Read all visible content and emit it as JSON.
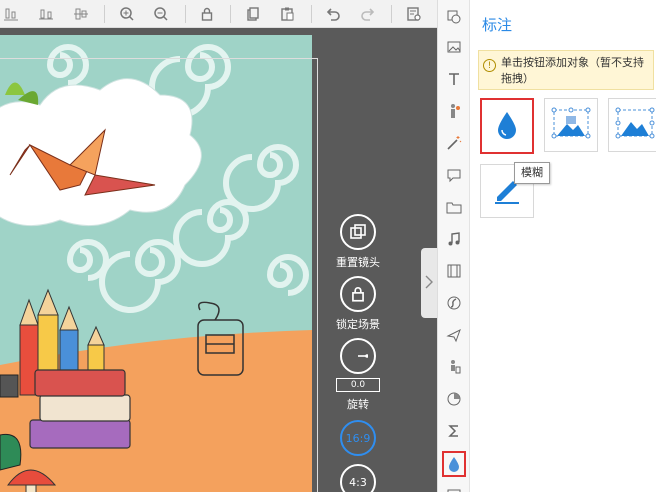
{
  "toolbar": {
    "buttons": [
      "align-bottom-icon",
      "align-center-icon",
      "align-middle-icon",
      "zoom-in-icon",
      "zoom-out-icon",
      "lock-icon",
      "copy-icon",
      "paste-icon",
      "undo-icon",
      "redo-icon",
      "preview-icon"
    ]
  },
  "camera": {
    "reset_label": "重置镜头",
    "lock_label": "锁定场景",
    "rotate_value": "0.0",
    "rotate_label": "旋转",
    "ratio_16_9": "16:9",
    "ratio_4_3": "4:3"
  },
  "strip": {
    "items": [
      "shape-icon",
      "image-icon",
      "text-icon",
      "character-icon",
      "effect-wand-icon",
      "speech-bubble-icon",
      "folder-icon",
      "music-icon",
      "film-icon",
      "flash-icon",
      "plane-icon",
      "pointer-figure-icon",
      "pie-chart-icon",
      "sigma-icon",
      "droplet-icon",
      "more-icon"
    ]
  },
  "panel": {
    "title": "标注",
    "notice": "单击按钮添加对象（暂不支持拖拽）",
    "tooltip": "模糊",
    "tiles": [
      "blur-droplet-icon",
      "mosaic-frame-icon",
      "mosaic-frame-alt-icon",
      "pen-icon"
    ]
  },
  "colors": {
    "accent": "#2b8ae6",
    "selection": "#e03131",
    "canvas_bg": "#5a5a5a",
    "scene_bg": "#9fd3c7"
  }
}
